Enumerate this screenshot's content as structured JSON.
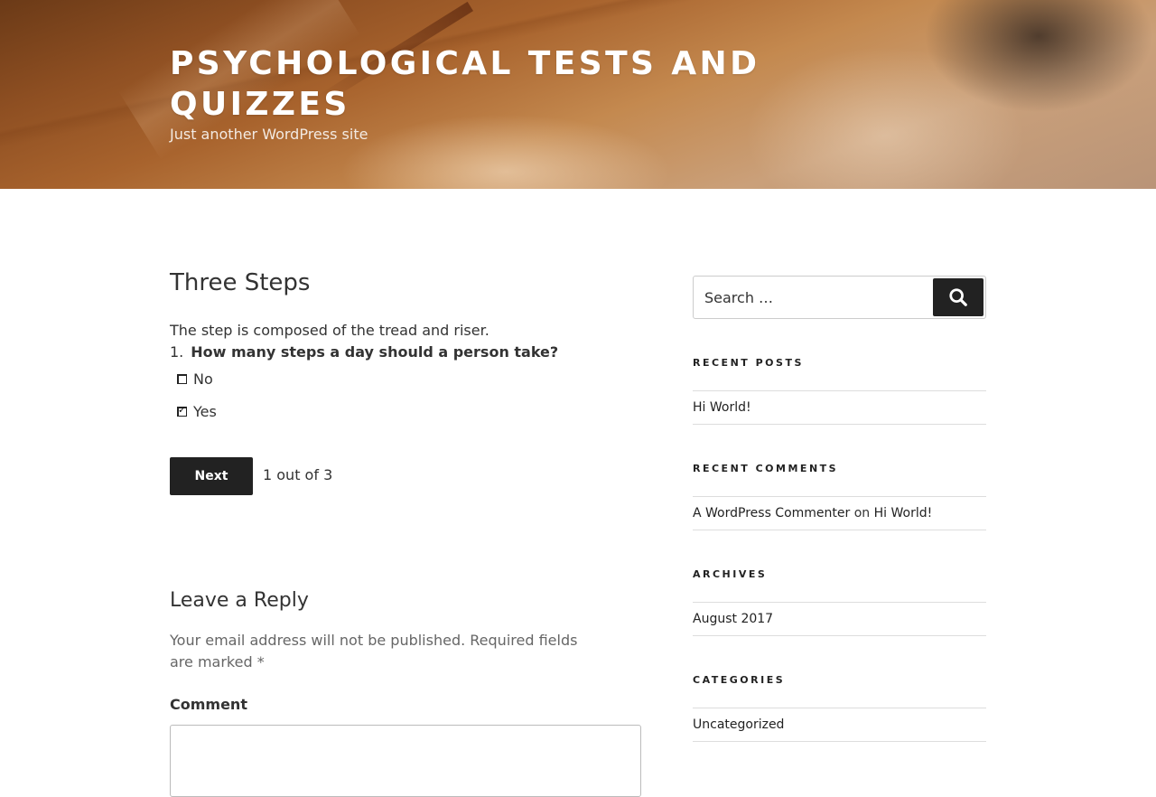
{
  "header": {
    "site_title": "PSYCHOLOGICAL TESTS AND QUIZZES",
    "site_description": "Just another WordPress site"
  },
  "quiz": {
    "title": "Three Steps",
    "intro": "The step is composed of the tread and riser.",
    "question_number": "1.",
    "question_text": "How many steps a day should a person take?",
    "answers": [
      {
        "label": "No",
        "checked": false
      },
      {
        "label": "Yes",
        "checked": true
      }
    ],
    "next_label": "Next",
    "progress": "1 out of 3"
  },
  "reply": {
    "title": "Leave a Reply",
    "notes": "Your email address will not be published. Required fields are marked *",
    "comment_label": "Comment"
  },
  "sidebar": {
    "search": {
      "placeholder": "Search …",
      "button_label": "Search",
      "icon": "search-icon"
    },
    "recent_posts": {
      "title": "RECENT POSTS",
      "items": [
        "Hi World!"
      ]
    },
    "recent_comments": {
      "title": "RECENT COMMENTS",
      "items": [
        {
          "author": "A WordPress Commenter",
          "on": "on",
          "post": "Hi World!"
        }
      ]
    },
    "archives": {
      "title": "ARCHIVES",
      "items": [
        "August 2017"
      ]
    },
    "categories": {
      "title": "CATEGORIES",
      "items": [
        "Uncategorized"
      ]
    }
  }
}
